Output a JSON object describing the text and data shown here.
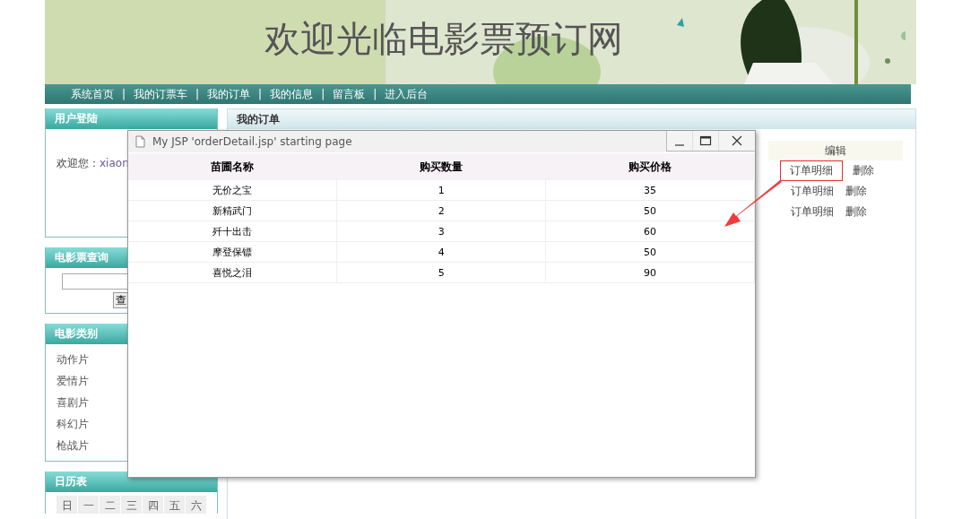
{
  "banner": {
    "title": "欢迎光临电影票预订网"
  },
  "nav": [
    {
      "label": "系统首页",
      "separator": "|"
    },
    {
      "label": "我的订票车",
      "separator": "|"
    },
    {
      "label": "我的订单",
      "separator": "|"
    },
    {
      "label": "我的信息",
      "separator": "|"
    },
    {
      "label": "留言板",
      "separator": "|"
    },
    {
      "label": "进入后台"
    }
  ],
  "login": {
    "title": "用户登陆",
    "greeting": "欢迎您：",
    "user": "xiaon"
  },
  "search": {
    "title": "电影票查询",
    "button": "查"
  },
  "categories": {
    "title": "电影类别",
    "items": [
      "动作片",
      "爱情片",
      "喜剧片",
      "科幻片",
      "枪战片"
    ]
  },
  "calendar": {
    "title": "日历表",
    "weekdays": [
      "日",
      "一",
      "二",
      "三",
      "四",
      "五",
      "六"
    ]
  },
  "orders": {
    "title": "我的订单",
    "column": "编辑",
    "rows": [
      {
        "detail": "订单明细",
        "delete": "删除",
        "highlighted": true
      },
      {
        "detail": "订单明细",
        "delete": "删除",
        "highlighted": false
      },
      {
        "detail": "订单明细",
        "delete": "删除",
        "highlighted": false
      }
    ]
  },
  "popup": {
    "title": "My JSP 'orderDetail.jsp' starting page",
    "columns": [
      "苗圃名称",
      "购买数量",
      "购买价格"
    ],
    "rows": [
      [
        "无价之宝",
        "1",
        "35"
      ],
      [
        "新精武门",
        "2",
        "50"
      ],
      [
        "歼十出击",
        "3",
        "60"
      ],
      [
        "摩登保镖",
        "4",
        "50"
      ],
      [
        "喜悦之泪",
        "5",
        "90"
      ]
    ]
  }
}
